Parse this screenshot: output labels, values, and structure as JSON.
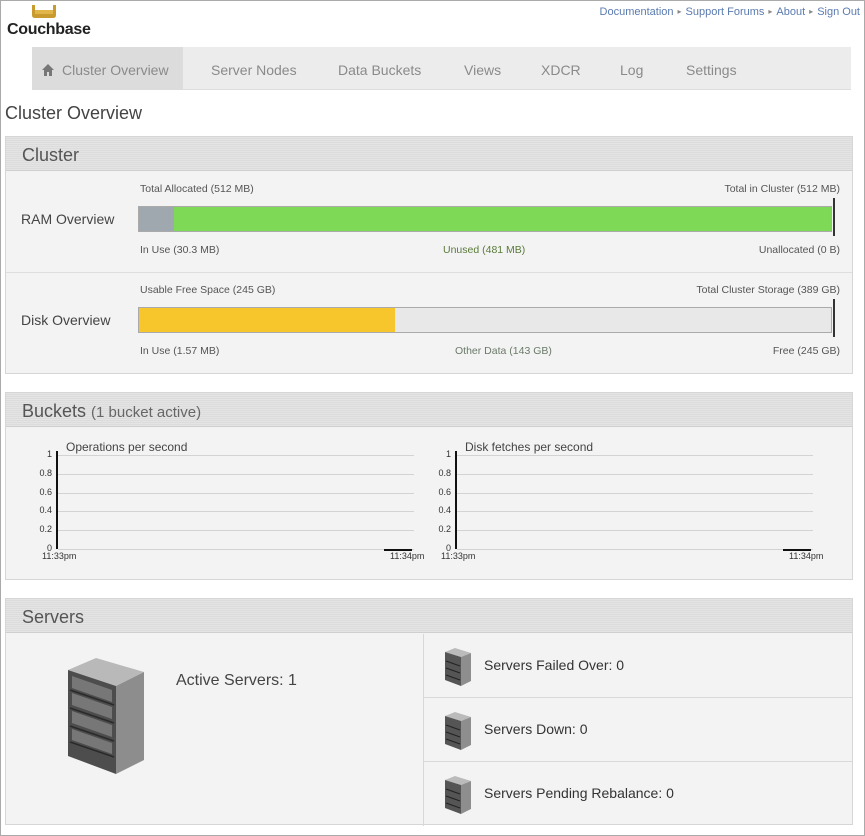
{
  "app": {
    "logo_text": "Couchbase"
  },
  "top_links": [
    "Documentation",
    "Support Forums",
    "About",
    "Sign Out"
  ],
  "nav": {
    "tabs": [
      "Cluster Overview",
      "Server Nodes",
      "Data Buckets",
      "Views",
      "XDCR",
      "Log",
      "Settings"
    ],
    "active": "Cluster Overview"
  },
  "page_title": "Cluster Overview",
  "cluster": {
    "title": "Cluster",
    "ram": {
      "label": "RAM Overview",
      "top_left": "Total Allocated (512 MB)",
      "top_right": "Total in Cluster (512 MB)",
      "in_use": "In Use (30.3 MB)",
      "unused": "Unused (481 MB)",
      "unallocated": "Unallocated (0 B)",
      "in_use_fraction": 0.05,
      "unused_fraction": 0.95
    },
    "disk": {
      "label": "Disk Overview",
      "top_left": "Usable Free Space (245 GB)",
      "top_right": "Total Cluster Storage (389 GB)",
      "in_use": "In Use (1.57 MB)",
      "other": "Other Data (143 GB)",
      "free": "Free (245 GB)",
      "used_fraction": 0.37
    }
  },
  "buckets": {
    "title": "Buckets",
    "subtitle": "(1 bucket active)"
  },
  "chart_data": [
    {
      "type": "line",
      "title": "Operations per second",
      "yticks": [
        "1",
        "0.8",
        "0.6",
        "0.4",
        "0.2",
        "0"
      ],
      "xticks": [
        "11:33pm",
        "11:34pm"
      ],
      "ylim": [
        0,
        1
      ],
      "series": [
        {
          "values": [
            0,
            0
          ]
        }
      ]
    },
    {
      "type": "line",
      "title": "Disk fetches per second",
      "yticks": [
        "1",
        "0.8",
        "0.6",
        "0.4",
        "0.2",
        "0"
      ],
      "xticks": [
        "11:33pm",
        "11:34pm"
      ],
      "ylim": [
        0,
        1
      ],
      "series": [
        {
          "values": [
            0,
            0
          ]
        }
      ]
    }
  ],
  "servers": {
    "title": "Servers",
    "active": "Active Servers: 1",
    "failed_over": "Servers Failed Over: 0",
    "down": "Servers Down: 0",
    "pending_rebalance": "Servers Pending Rebalance: 0"
  },
  "colors": {
    "ram_in_use": "#9ea8ae",
    "ram_unused": "#7ed957",
    "disk_in_use": "#f7c62d",
    "bar_empty": "#e8e8e8"
  }
}
